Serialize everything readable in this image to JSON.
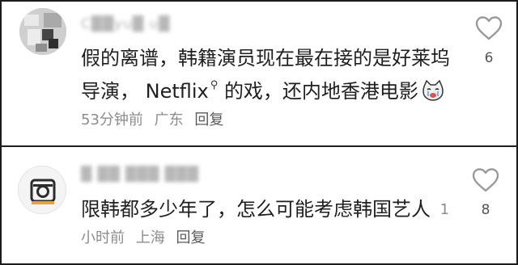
{
  "comments": [
    {
      "username": "C██yu█ u█",
      "text_a": "假的离谱，韩籍演员现在最在接的是好莱坞导演，",
      "brand": "Netflix",
      "search_icon": "search-icon",
      "text_b": "的戏，还内地香港电影",
      "emoji": "crying-cat-emoji",
      "time": "53分钟前",
      "location": "广东",
      "reply": "回复",
      "likes": "6"
    },
    {
      "username": "█ ██ ███ ███",
      "text": "限韩都多少年了，怎么可能考虑韩国艺人",
      "time": "1小时前",
      "location": "上海",
      "reply": "回复",
      "likes": "8"
    }
  ],
  "colors": {
    "text": "#1f1f1f",
    "meta": "#8c8c8c",
    "icon": "#9a9a9a"
  }
}
